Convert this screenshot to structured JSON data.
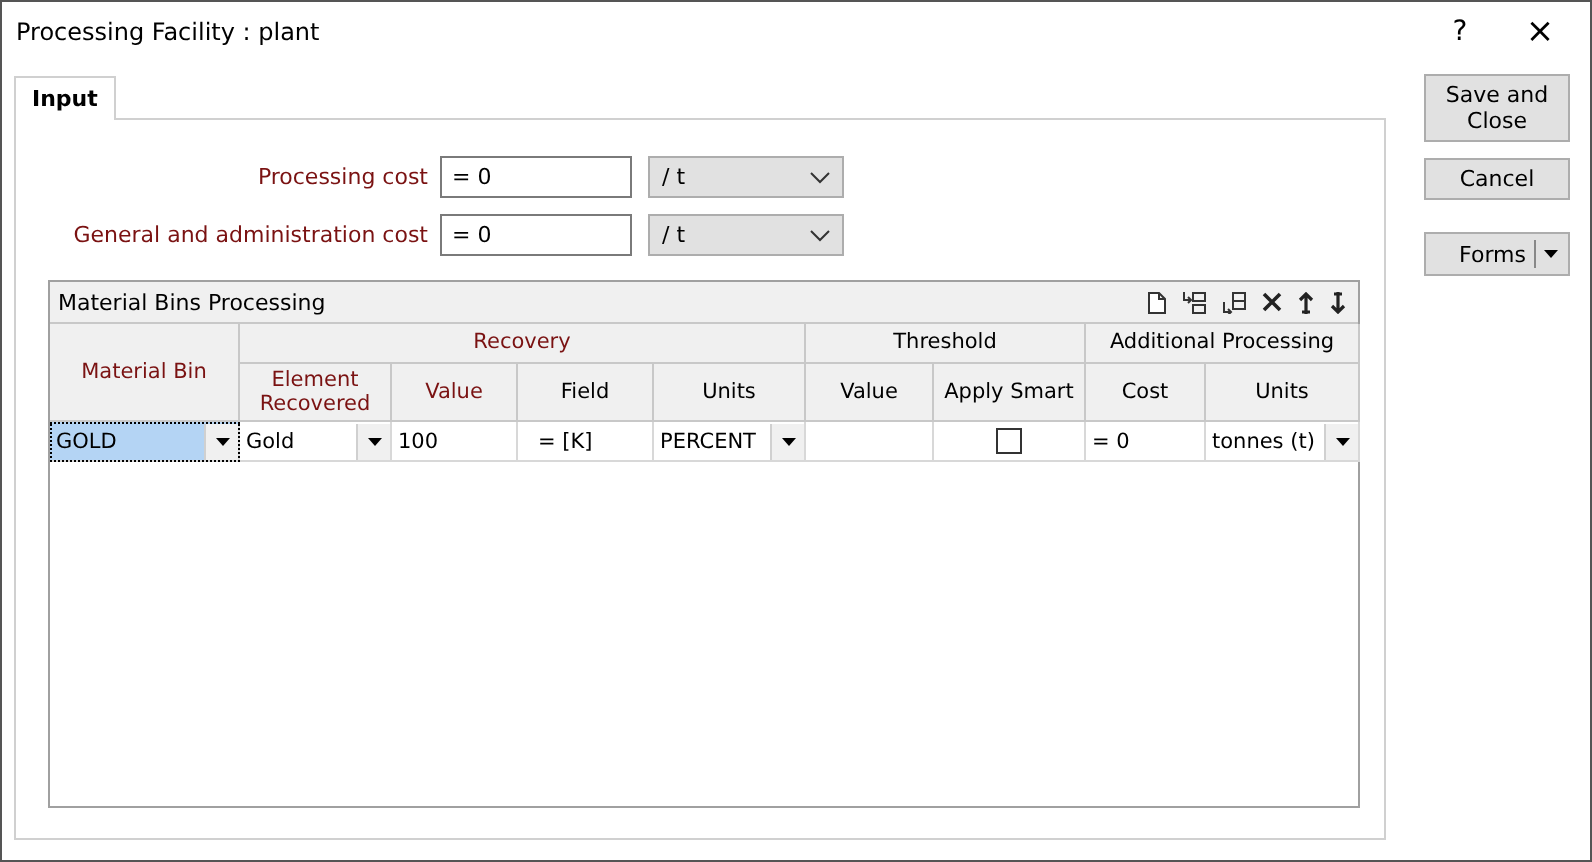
{
  "window": {
    "title": "Processing Facility : plant",
    "help": "?",
    "close": "×"
  },
  "tabs": [
    {
      "label": "Input",
      "selected": true
    }
  ],
  "cost_fields": [
    {
      "label": "Processing cost",
      "value": "= 0",
      "unit": "/ t"
    },
    {
      "label": "General and administration cost",
      "value": "= 0",
      "unit": "/ t"
    }
  ],
  "grid": {
    "title": "Material Bins Processing",
    "columns": [
      {
        "label": "Material Bin",
        "required": true
      }
    ],
    "groups": [
      {
        "label": "Recovery",
        "required": true,
        "columns": [
          {
            "label": "Element Recovered",
            "required": true
          },
          {
            "label": "Value",
            "required": true
          },
          {
            "label": "Field",
            "required": false
          },
          {
            "label": "Units",
            "required": false
          }
        ]
      },
      {
        "label": "Threshold",
        "required": false,
        "columns": [
          {
            "label": "Value",
            "required": false
          },
          {
            "label": "Apply Smart",
            "required": false
          }
        ]
      },
      {
        "label": "Additional Processing",
        "required": false,
        "columns": [
          {
            "label": "Cost",
            "required": false
          },
          {
            "label": "Units",
            "required": false
          }
        ]
      }
    ],
    "rows": [
      {
        "selected": true,
        "cells": [
          {
            "kind": "combo",
            "value": "GOLD"
          },
          {
            "kind": "combo",
            "value": "Gold"
          },
          {
            "kind": "text",
            "value": "100"
          },
          {
            "kind": "text",
            "value": "=  [K]"
          },
          {
            "kind": "combo",
            "value": "PERCENT"
          },
          {
            "kind": "empty"
          },
          {
            "kind": "check",
            "checked": false
          },
          {
            "kind": "text",
            "value": "=  0"
          },
          {
            "kind": "combo",
            "value": "tonnes (t)"
          }
        ]
      }
    ]
  },
  "buttons": [
    {
      "label": "Save and Close",
      "kind": "push"
    },
    {
      "label": "Cancel",
      "kind": "push"
    },
    {
      "label": "Forms",
      "kind": "split"
    }
  ]
}
